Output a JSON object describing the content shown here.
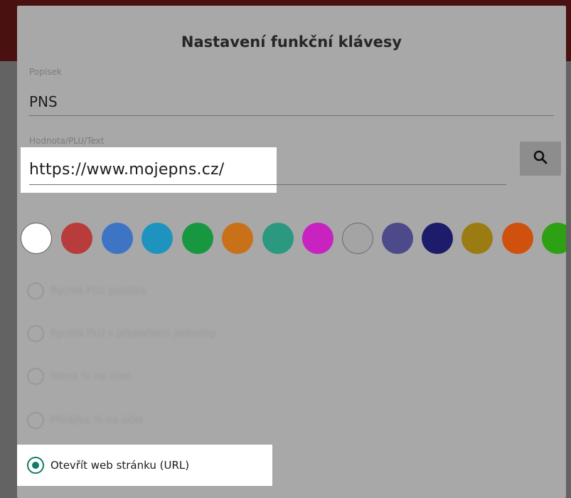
{
  "dialog": {
    "title": "Nastavení funkční klávesy"
  },
  "fields": {
    "popisek": {
      "label": "Popisek",
      "value": "PNS"
    },
    "hodnota": {
      "label": "Hodnota/PLU/Text",
      "value": "https://www.mojepns.cz/"
    }
  },
  "search_button": {
    "icon": "search-icon"
  },
  "colors": {
    "swatches": [
      {
        "name": "white",
        "hex": "#ffffff"
      },
      {
        "name": "red",
        "hex": "#b83c3c"
      },
      {
        "name": "blue",
        "hex": "#3d74c4"
      },
      {
        "name": "cyan",
        "hex": "#1f93c0"
      },
      {
        "name": "green",
        "hex": "#179840"
      },
      {
        "name": "orange",
        "hex": "#c97118"
      },
      {
        "name": "teal",
        "hex": "#2a9980"
      },
      {
        "name": "magenta",
        "hex": "#c822c0"
      },
      {
        "name": "light-gray",
        "hex": "#a4a4a4"
      },
      {
        "name": "violet",
        "hex": "#4d4a8c"
      },
      {
        "name": "navy",
        "hex": "#1c1c6a"
      },
      {
        "name": "olive",
        "hex": "#9b7c12"
      },
      {
        "name": "dark-orange",
        "hex": "#d0500e"
      },
      {
        "name": "lime",
        "hex": "#2ea014"
      }
    ],
    "accent": "#127a67"
  },
  "options": [
    {
      "label": "Rychlá PLU položka",
      "selected": false
    },
    {
      "label": "Rychlá PLU s přepočtem jednotky",
      "selected": false
    },
    {
      "label": "Sleva % na účet",
      "selected": false
    },
    {
      "label": "Přirážka % na účet",
      "selected": false
    },
    {
      "label": "Otevřít web stránku (URL)",
      "selected": true
    }
  ]
}
